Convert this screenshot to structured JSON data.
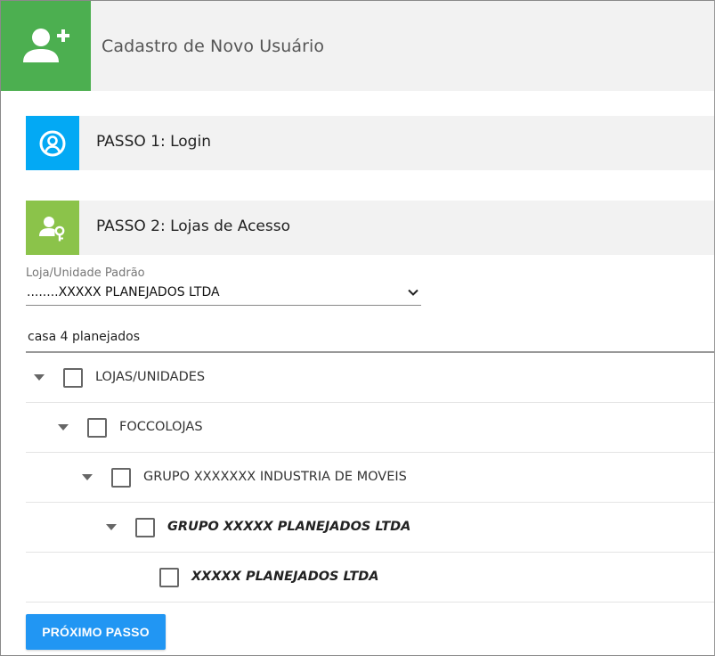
{
  "header": {
    "title": "Cadastro de Novo Usuário",
    "icon": "add-user-icon",
    "color": "#4caf50"
  },
  "steps": [
    {
      "label": "PASSO 1: Login",
      "icon": "account-circle-icon",
      "color": "#03a9f4"
    },
    {
      "label": "PASSO 2: Lojas de Acesso",
      "icon": "user-key-icon",
      "color": "#8bc34a"
    }
  ],
  "default_store": {
    "label": "Loja/Unidade Padrão",
    "value": "........XXXXX PLANEJADOS LTDA"
  },
  "search": {
    "value": "casa 4 planejados"
  },
  "tree": [
    {
      "label": "LOJAS/UNIDADES",
      "level": 0,
      "expandable": true,
      "checked": false,
      "emphasis": false
    },
    {
      "label": "FOCCOLOJAS",
      "level": 1,
      "expandable": true,
      "checked": false,
      "emphasis": false
    },
    {
      "label": "GRUPO XXXXXXX INDUSTRIA DE MOVEIS",
      "level": 2,
      "expandable": true,
      "checked": false,
      "emphasis": false
    },
    {
      "label": "GRUPO XXXXX PLANEJADOS LTDA",
      "level": 3,
      "expandable": true,
      "checked": false,
      "emphasis": true
    },
    {
      "label": "XXXXX PLANEJADOS LTDA",
      "level": 4,
      "expandable": false,
      "checked": false,
      "emphasis": true
    }
  ],
  "next_button": {
    "label": "PRÓXIMO PASSO",
    "color": "#2196f3"
  }
}
